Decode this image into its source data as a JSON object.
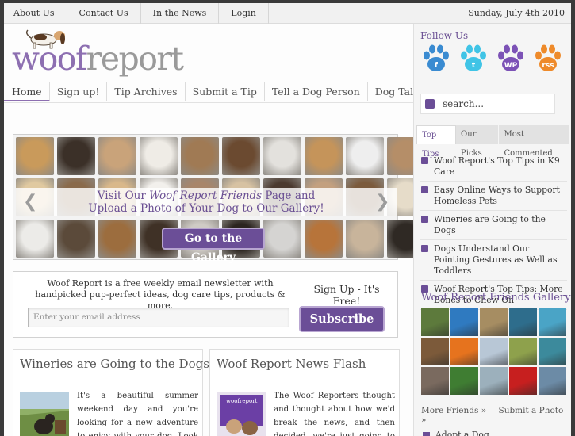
{
  "topnav": [
    "About Us",
    "Contact Us",
    "In the News",
    "Login"
  ],
  "date": "Sunday, July 4th 2010",
  "logo": {
    "woof": "woof",
    "report": "report"
  },
  "mainnav": [
    "Home",
    "Sign up!",
    "Tip Archives",
    "Submit a Tip",
    "Tell a Dog Person",
    "Dog Talk Forum"
  ],
  "gallery": {
    "promo_line1_a": "Visit Our ",
    "promo_line1_em": "Woof Report Friends",
    "promo_line1_b": " Page and",
    "promo_line2": "Upload a Photo of  Your Dog to Our Gallery!",
    "button": "Go to the Gallery",
    "thumb_colors": [
      "#c99a5b",
      "#3b3028",
      "#c9a37a",
      "#efece6",
      "#a07a54",
      "#6b4a30",
      "#e3e1dd",
      "#c5945a",
      "#eeeeee",
      "#b58e68",
      "#e0c9a0",
      "#8a6a4b",
      "#d9b88a",
      "#f2f0ec",
      "#a8856a",
      "#d7c2a2",
      "#4b3a2f",
      "#c3a07f",
      "#7b5a3c",
      "#e6dcc9",
      "#ecebe8",
      "#5b4a3a",
      "#9c6d3e",
      "#3f3126",
      "#cfcbc5",
      "#2b241f",
      "#d5d4d2",
      "#b7743a",
      "#c8b49b",
      "#2f2924"
    ]
  },
  "newsletter": {
    "text": "Woof Report is a free weekly email newsletter with handpicked pup-perfect ideas, dog care tips, products & more.",
    "placeholder": "Enter your email address",
    "signup": "Sign Up - It's Free!",
    "button": "Subscribe"
  },
  "articles": [
    {
      "title": "Wineries are Going to the Dogs",
      "body": "It's a beautiful summer weekend day and you're looking for a new adventure to enjoy with your dog. Look no further than your"
    },
    {
      "title": "Woof Report News Flash",
      "body": "The Woof Reporters thought and thought about how we'd break the news, and then decided, we're just going to say it. After"
    }
  ],
  "sidebar": {
    "follow": "Follow Us",
    "social": [
      {
        "icon": "facebook-paw-icon",
        "color": "#3a8bd1",
        "glyph": "f"
      },
      {
        "icon": "twitter-paw-icon",
        "color": "#40c4e6",
        "glyph": "t"
      },
      {
        "icon": "wordpress-paw-icon",
        "color": "#7c52b6",
        "glyph": "WP"
      },
      {
        "icon": "rss-paw-icon",
        "color": "#ee8a2a",
        "glyph": "rss"
      }
    ],
    "search": "search...",
    "tabs": [
      "Top Tips",
      "Our Picks",
      "Most Commented"
    ],
    "tips": [
      "Woof Report's Top Tips in K9 Care",
      "Easy Online Ways to Support Homeless Pets",
      "Wineries are Going to the Dogs",
      "Dogs Understand Our Pointing Gestures as Well as Toddlers",
      "Woof Report's Top Tips: More Bones to Chew On"
    ],
    "friends_title": "Woof Report Friends Gallery",
    "friends_colors": [
      "#5d7a3c",
      "#2f7ac0",
      "#a68d62",
      "#2e6d8c",
      "#4aa4c6",
      "#7c5a3a",
      "#e6731e",
      "#b8c7d6",
      "#8ea14c",
      "#3c8a9c",
      "#7a6a5f",
      "#3f7d32",
      "#9cb0bc",
      "#c71f1f",
      "#6c8ba6"
    ],
    "more_friends": "More Friends »",
    "submit_photo": "Submit a Photo »",
    "adopt": "Adopt a Dog"
  }
}
